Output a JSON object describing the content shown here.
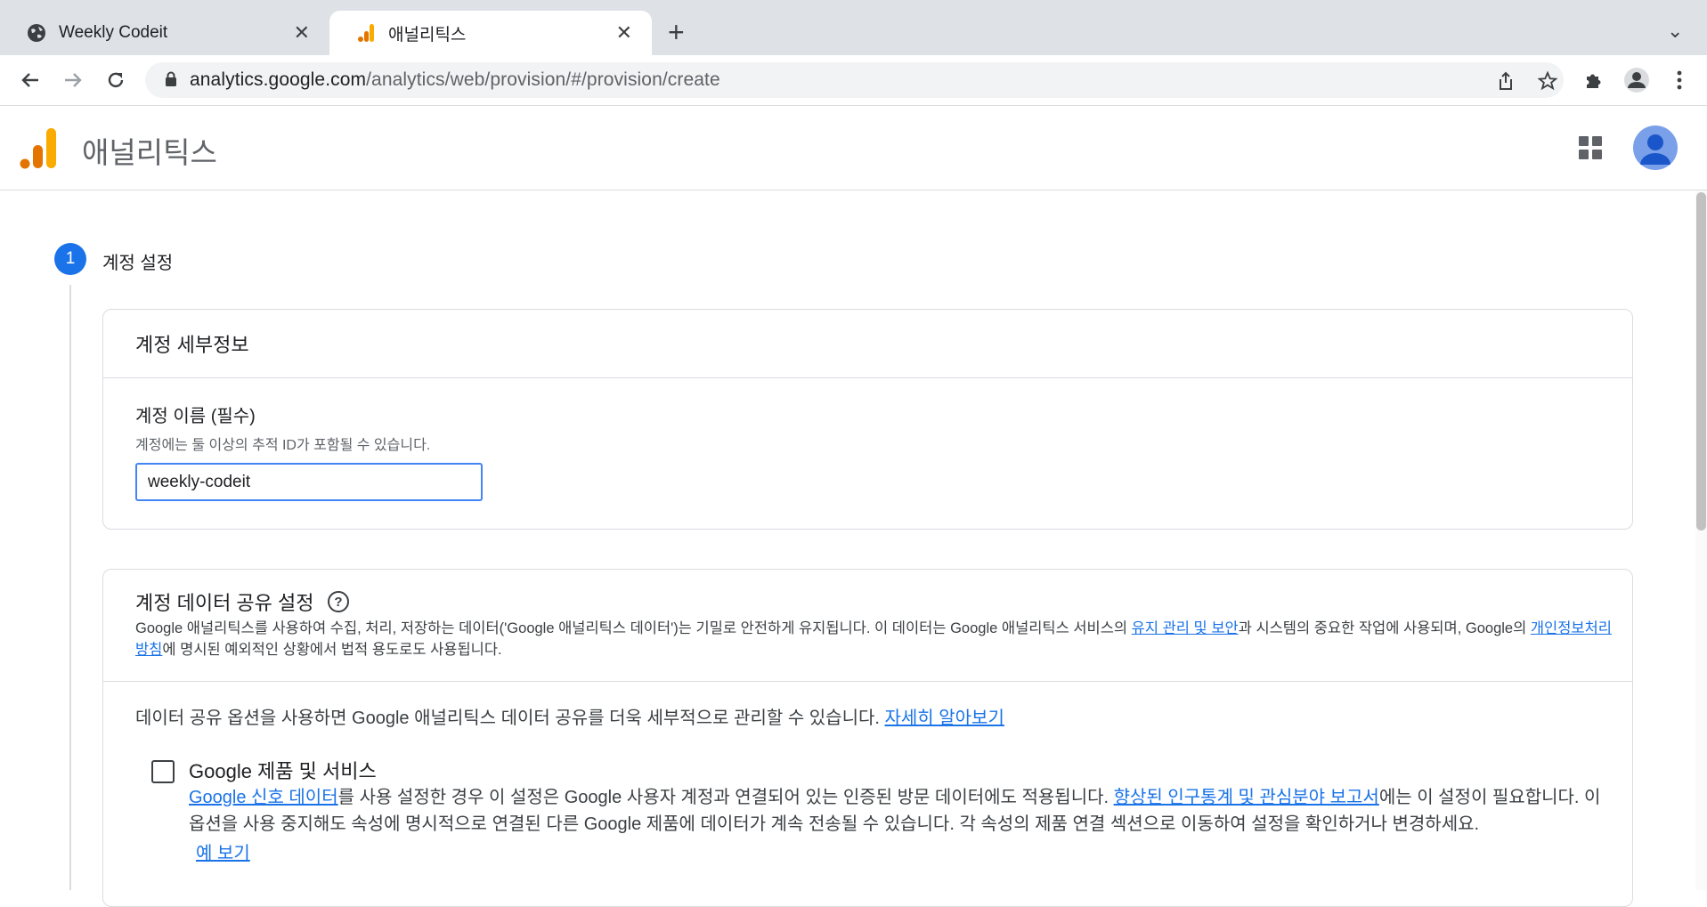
{
  "browser": {
    "tabs": [
      {
        "title": "Weekly Codeit",
        "icon": "globe-icon"
      },
      {
        "title": "애널리틱스",
        "icon": "analytics-logo-icon"
      }
    ],
    "new_tab": "+",
    "url_host": "analytics.google.com",
    "url_path": "/analytics/web/provision/#/provision/create"
  },
  "app": {
    "title": "애널리틱스",
    "accent": "#1a73e8",
    "logo_colors": [
      "#e37400",
      "#f9ab00"
    ]
  },
  "step": {
    "number": "1",
    "label": "계정 설정"
  },
  "account_details": {
    "title": "계정 세부정보",
    "field_label": "계정 이름 (필수)",
    "field_help": "계정에는 둘 이상의 추적 ID가 포함될 수 있습니다.",
    "field_value": "weekly-codeit"
  },
  "data_sharing": {
    "title": "계정 데이터 공유 설정",
    "desc_part1": "Google 애널리틱스를 사용하여 수집, 처리, 저장하는 데이터('Google 애널리틱스 데이터')는 기밀로 안전하게 유지됩니다. 이 데이터는 Google 애널리틱스 서비스의 ",
    "desc_link1": "유지 관리 및 보안",
    "desc_part2": "과 시스템의 중요한 작업에 사용되며, Google의 ",
    "desc_link2": "개인정보처리방침",
    "desc_part3": "에 명시된 예외적인 상황에서 법적 용도로도 사용됩니다.",
    "intro_text": "데이터 공유 옵션을 사용하면 Google 애널리틱스 데이터 공유를 더욱 세부적으로 관리할 수 있습니다. ",
    "intro_link": "자세히 알아보기",
    "option": {
      "title": "Google 제품 및 서비스",
      "checked": false,
      "link1": "Google 신호 데이터",
      "text1": "를 사용 설정한 경우 이 설정은 Google 사용자 계정과 연결되어 있는 인증된 방문 데이터에도 적용됩니다. ",
      "link2": "향상된 인구통계 및 관심분야 보고서",
      "text2": "에는 이 설정이 필요합니다. 이 옵션을 사용 중지해도 속성에 명시적으로 연결된 다른 Google 제품에 데이터가 계속 전송될 수 있습니다. 각 속성의 제품 연결 섹션으로 이동하여 설정을 확인하거나 변경하세요.",
      "example_link": "예 보기"
    }
  }
}
